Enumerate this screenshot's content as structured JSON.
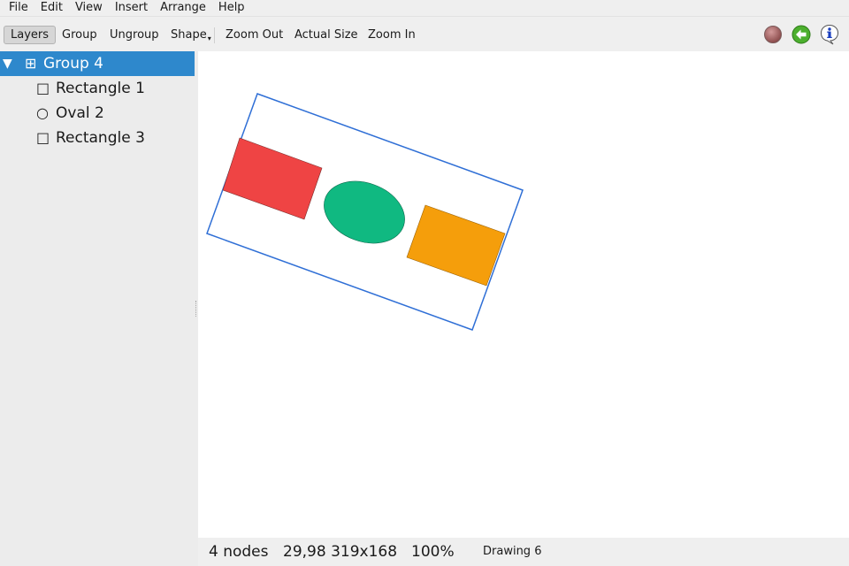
{
  "menubar": {
    "items": [
      "File",
      "Edit",
      "View",
      "Insert",
      "Arrange",
      "Help"
    ]
  },
  "toolbar": {
    "layers_label": "Layers",
    "group_label": "Group",
    "ungroup_label": "Ungroup",
    "shape_label": "Shape",
    "zoom_out_label": "Zoom Out",
    "actual_size_label": "Actual Size",
    "zoom_in_label": "Zoom In",
    "icons": [
      "stop-icon",
      "back-arrow-icon",
      "info-icon"
    ]
  },
  "layers": {
    "group": {
      "label": "Group 4",
      "expander": "▼",
      "glyph": "⊞",
      "selected": true
    },
    "children": [
      {
        "label": "Rectangle 1",
        "glyph": "□"
      },
      {
        "label": "Oval 2",
        "glyph": "○"
      },
      {
        "label": "Rectangle 3",
        "glyph": "□"
      }
    ]
  },
  "canvas": {
    "group_outline_color": "#2f6fd6",
    "shapes": [
      {
        "name": "Rectangle 1",
        "type": "rectangle",
        "fill": "#ef4444"
      },
      {
        "name": "Oval 2",
        "type": "oval",
        "fill": "#10b981"
      },
      {
        "name": "Rectangle 3",
        "type": "rectangle",
        "fill": "#f59e0b"
      }
    ]
  },
  "status": {
    "node_count": "4 nodes",
    "position_size": "29,98 319x168",
    "zoom": "100%",
    "document": "Drawing 6"
  }
}
